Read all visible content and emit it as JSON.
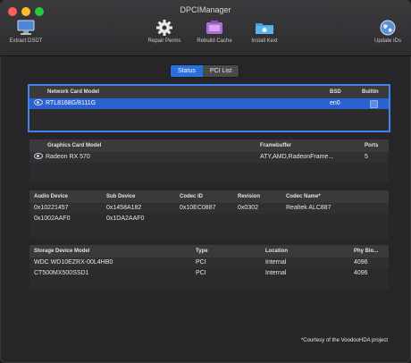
{
  "window": {
    "title": "DPCIManager"
  },
  "toolbar": {
    "extract_dsdt": "Extract DSDT",
    "repair_perms": "Repair Perms",
    "rebuild_cache": "Rebuild Cache",
    "install_kext": "Install Kext",
    "update_ids": "Update IDs"
  },
  "tabs": [
    {
      "label": "Status",
      "active": true
    },
    {
      "label": "PCI List",
      "active": false
    }
  ],
  "network": {
    "headers": {
      "model": "Network Card Model",
      "bsd": "BSD",
      "builtin": "Builtin"
    },
    "rows": [
      {
        "model": "RTL8168G/8111G",
        "bsd": "en0",
        "builtin": true
      }
    ]
  },
  "graphics": {
    "headers": {
      "model": "Graphics Card Model",
      "framebuffer": "Framebuffer",
      "ports": "Ports"
    },
    "rows": [
      {
        "model": "Radeon RX 570",
        "framebuffer": "ATY,AMD,RadeonFrame...",
        "ports": "5"
      }
    ]
  },
  "audio": {
    "headers": {
      "device": "Audio Device",
      "sub": "Sub Device",
      "codec_id": "Codec ID",
      "revision": "Revision",
      "codec_name": "Codec Name*"
    },
    "rows": [
      {
        "device": "0x10221457",
        "sub": "0x1458A182",
        "codec_id": "0x10EC0887",
        "revision": "0x0302",
        "codec_name": "Realtek ALC887"
      },
      {
        "device": "0x1002AAF0",
        "sub": "0x1DA2AAF0",
        "codec_id": "",
        "revision": "",
        "codec_name": ""
      }
    ]
  },
  "storage": {
    "headers": {
      "model": "Storage Device Model",
      "type": "Type",
      "location": "Location",
      "phy": "Phy Blo..."
    },
    "rows": [
      {
        "model": "WDC WD10EZRX-00L4HB0",
        "type": "PCI",
        "location": "Internal",
        "phy": "4096"
      },
      {
        "model": "CT500MX500SSD1",
        "type": "PCI",
        "location": "Internal",
        "phy": "4096"
      }
    ]
  },
  "footer": {
    "note": "*Courtesy of the VoodooHDA project"
  },
  "colors": {
    "accent": "#2a62cf",
    "focus": "#3f82f0",
    "window_bg": "#262628"
  }
}
